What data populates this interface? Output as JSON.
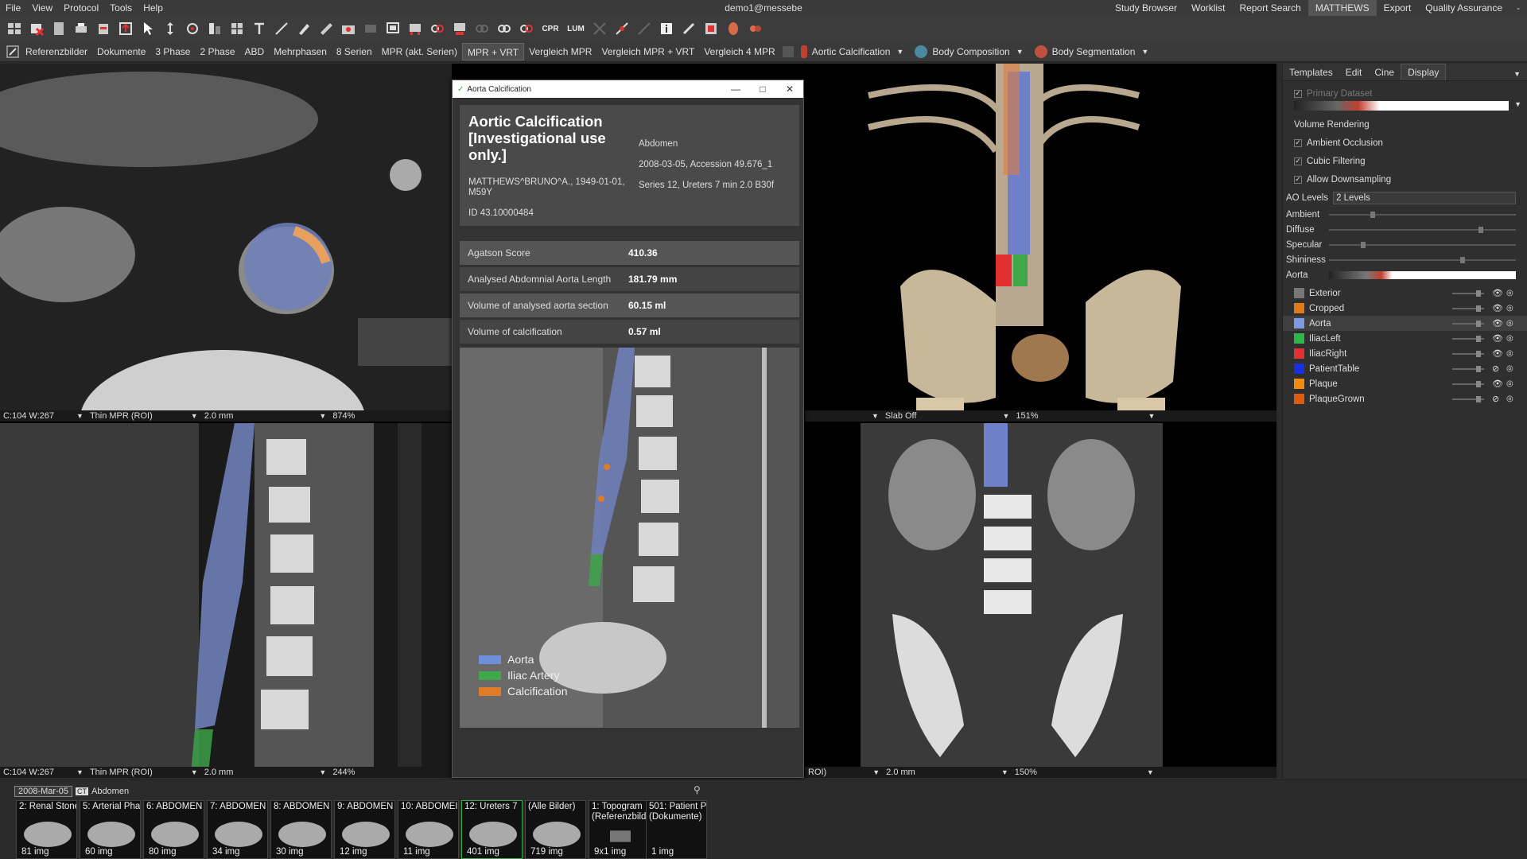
{
  "menubar": {
    "menus": [
      "File",
      "View",
      "Protocol",
      "Tools",
      "Help"
    ],
    "user": "demo1@messebe",
    "right_items": [
      "Study Browser",
      "Worklist",
      "Report Search",
      "MATTHEWS",
      "Export",
      "Quality Assurance"
    ],
    "minimize": "-"
  },
  "protocolbar": {
    "items": [
      "Referenzbilder",
      "Dokumente",
      "3 Phase",
      "2 Phase",
      "ABD",
      "Mehrphasen",
      "8 Serien",
      "MPR (akt. Serien)",
      "MPR + VRT",
      "Vergleich MPR",
      "Vergleich MPR + VRT",
      "Vergleich 4 MPR"
    ],
    "active": "MPR + VRT",
    "extensions": [
      "Aortic Calcification",
      "Body Composition",
      "Body Segmentation"
    ]
  },
  "toolbar_text": {
    "cpr": "CPR",
    "lum": "LUM"
  },
  "viewports": {
    "top_left": {
      "wl": "C:104 W:267",
      "mode": "Thin MPR (ROI)",
      "thickness": "2.0 mm",
      "zoom": "874%"
    },
    "bottom_left": {
      "wl": "C:104 W:267",
      "mode": "Thin MPR (ROI)",
      "thickness": "2.0 mm",
      "zoom": "244%"
    },
    "top_right": {
      "mode": "Slab Off",
      "zoom": "151%"
    },
    "bottom_right": {
      "mode": "ROI)",
      "thickness": "2.0 mm",
      "zoom": "150%"
    }
  },
  "dialog": {
    "window_title": "Aorta Calcification",
    "title": "Aortic Calcification [Investigational use only.]",
    "patient": "MATTHEWS^BRUNO^A., 1949-01-01, M59Y",
    "id": "ID 43.10000484",
    "body_part": "Abdomen",
    "study": "2008-03-05, Accession 49.676_1",
    "series": "Series 12, Ureters 7 min 2.0 B30f",
    "metrics": [
      {
        "label": "Agatson Score",
        "value": "410.36"
      },
      {
        "label": "Analysed Abdomnial Aorta Length",
        "value": "181.79 mm"
      },
      {
        "label": "Volume of analysed aorta section",
        "value": "60.15 ml"
      },
      {
        "label": "Volume of calcification",
        "value": "0.57 ml"
      }
    ],
    "legend": [
      {
        "label": "Aorta",
        "color": "#6f8fd8"
      },
      {
        "label": "Iliac Artery",
        "color": "#3fa84a"
      },
      {
        "label": "Calcification",
        "color": "#e07b2a"
      }
    ]
  },
  "right_panel": {
    "tabs": [
      "Templates",
      "Edit",
      "Cine",
      "Display"
    ],
    "active_tab": "Display",
    "primary_dataset": "Primary Dataset",
    "section": "Volume Rendering",
    "options": [
      "Ambient Occlusion",
      "Cubic Filtering",
      "Allow Downsampling"
    ],
    "ao_levels_label": "AO Levels",
    "ao_levels_value": "2 Levels",
    "lighting": [
      {
        "label": "Ambient",
        "level": 0.22
      },
      {
        "label": "Diffuse",
        "level": 0.8
      },
      {
        "label": "Specular",
        "level": 0.17
      },
      {
        "label": "Shininess",
        "level": 0.7
      }
    ],
    "aorta_label": "Aorta",
    "segments": [
      {
        "label": "Exterior",
        "color": "#777777"
      },
      {
        "label": "Cropped",
        "color": "#e07b1a"
      },
      {
        "label": "Aorta",
        "color": "#7c9be0"
      },
      {
        "label": "IliacLeft",
        "color": "#2fb54a"
      },
      {
        "label": "IliacRight",
        "color": "#e03030"
      },
      {
        "label": "PatientTable",
        "color": "#1a2fe0"
      },
      {
        "label": "Plaque",
        "color": "#f08a10"
      },
      {
        "label": "PlaqueGrown",
        "color": "#e05a10"
      }
    ]
  },
  "filmstrip": {
    "date": "2008-Mar-05",
    "ct": "CT",
    "body": "Abdomen",
    "series": [
      {
        "label": "2: Renal Stone",
        "count": "81 img"
      },
      {
        "label": "5: Arterial Pha",
        "count": "60 img"
      },
      {
        "label": "6: ABDOMEN",
        "count": "80 img"
      },
      {
        "label": "7: ABDOMEN",
        "count": "34 img"
      },
      {
        "label": "8: ABDOMEN",
        "count": "30 img"
      },
      {
        "label": "9: ABDOMEN",
        "count": "12 img"
      },
      {
        "label": "10: ABDOMEI",
        "count": "11 img"
      },
      {
        "label": "12: Ureters 7",
        "count": "401 img"
      },
      {
        "label": "(Alle Bilder)",
        "count": "719 img"
      },
      {
        "label": "1: Topogram (Referenzbild",
        "count": "9x1 img"
      },
      {
        "label": "501: Patient P (Dokumente)",
        "count": "1 img"
      }
    ]
  }
}
